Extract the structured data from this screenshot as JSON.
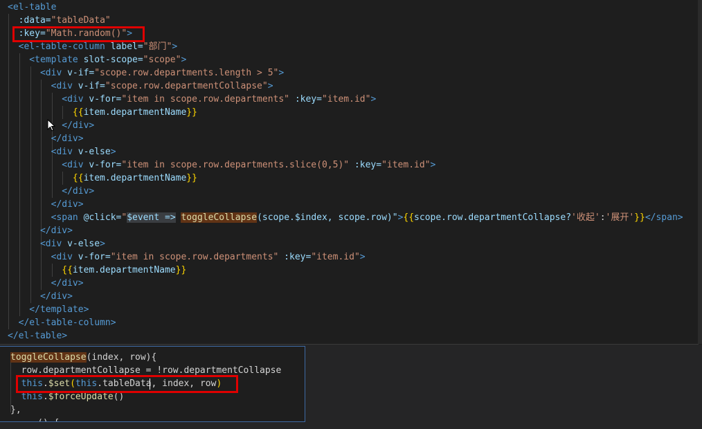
{
  "top_code": [
    [
      {
        "t": "<el-table",
        "c": "tag"
      }
    ],
    [
      {
        "t": "  :data=",
        "c": "attr"
      },
      {
        "t": "\"tableData\"",
        "c": "str"
      }
    ],
    [
      {
        "t": "  :key=",
        "c": "attr"
      },
      {
        "t": "\"Math.random()\"",
        "c": "str"
      },
      {
        "t": ">",
        "c": "tag"
      }
    ],
    [
      {
        "t": "  <el-table-column ",
        "c": "tag"
      },
      {
        "t": "label=",
        "c": "attr"
      },
      {
        "t": "\"部门\"",
        "c": "str"
      },
      {
        "t": ">",
        "c": "tag"
      }
    ],
    [
      {
        "t": "    <template ",
        "c": "tag"
      },
      {
        "t": "slot-scope=",
        "c": "attr"
      },
      {
        "t": "\"scope\"",
        "c": "str"
      },
      {
        "t": ">",
        "c": "tag"
      }
    ],
    [
      {
        "t": "      <div ",
        "c": "tag"
      },
      {
        "t": "v-if=",
        "c": "attr"
      },
      {
        "t": "\"scope.row.departments.length > 5\"",
        "c": "str"
      },
      {
        "t": ">",
        "c": "tag"
      }
    ],
    [
      {
        "t": "        <div ",
        "c": "tag"
      },
      {
        "t": "v-if=",
        "c": "attr"
      },
      {
        "t": "\"scope.row.departmentCollapse\"",
        "c": "str"
      },
      {
        "t": ">",
        "c": "tag"
      }
    ],
    [
      {
        "t": "          <div ",
        "c": "tag"
      },
      {
        "t": "v-for=",
        "c": "attr"
      },
      {
        "t": "\"item in scope.row.departments\"",
        "c": "str"
      },
      {
        "t": " :key=",
        "c": "attr"
      },
      {
        "t": "\"item.id\"",
        "c": "str"
      },
      {
        "t": ">",
        "c": "tag"
      }
    ],
    [
      {
        "t": "            {{",
        "c": "brace"
      },
      {
        "t": "item.departmentName",
        "c": "attr"
      },
      {
        "t": "}}",
        "c": "brace"
      }
    ],
    [
      {
        "t": "          </div>",
        "c": "tag"
      }
    ],
    [
      {
        "t": "        </div>",
        "c": "tag"
      }
    ],
    [
      {
        "t": "        <div ",
        "c": "tag"
      },
      {
        "t": "v-else",
        "c": "attr"
      },
      {
        "t": ">",
        "c": "tag"
      }
    ],
    [
      {
        "t": "          <div ",
        "c": "tag"
      },
      {
        "t": "v-for=",
        "c": "attr"
      },
      {
        "t": "\"item in scope.row.departments.slice(0,5)\"",
        "c": "str"
      },
      {
        "t": " :key=",
        "c": "attr"
      },
      {
        "t": "\"item.id\"",
        "c": "str"
      },
      {
        "t": ">",
        "c": "tag"
      }
    ],
    [
      {
        "t": "            {{",
        "c": "brace"
      },
      {
        "t": "item.departmentName",
        "c": "attr"
      },
      {
        "t": "}}",
        "c": "brace"
      }
    ],
    [
      {
        "t": "          </div>",
        "c": "tag"
      }
    ],
    [
      {
        "t": "        </div>",
        "c": "tag"
      }
    ],
    [
      {
        "t": "        <span ",
        "c": "tag"
      },
      {
        "t": "@click=",
        "c": "attr"
      },
      {
        "t": "\"",
        "c": "str"
      },
      {
        "t": "$event =>",
        "c": "ev"
      },
      {
        "t": " ",
        "c": "txt"
      },
      {
        "t": "toggleCollapse",
        "c": "fnhl"
      },
      {
        "t": "(scope.$index, scope.row)\"",
        "c": "attr"
      },
      {
        "t": ">",
        "c": "tag"
      },
      {
        "t": "{{",
        "c": "brace"
      },
      {
        "t": "scope.row.departmentCollapse?",
        "c": "attr"
      },
      {
        "t": "'收起'",
        "c": "str"
      },
      {
        "t": ":",
        "c": "txt"
      },
      {
        "t": "'展开'",
        "c": "str"
      },
      {
        "t": "}}",
        "c": "brace"
      },
      {
        "t": "</span>",
        "c": "tag"
      }
    ],
    [
      {
        "t": "      </div>",
        "c": "tag"
      }
    ],
    [
      {
        "t": "      <div ",
        "c": "tag"
      },
      {
        "t": "v-else",
        "c": "attr"
      },
      {
        "t": ">",
        "c": "tag"
      }
    ],
    [
      {
        "t": "        <div ",
        "c": "tag"
      },
      {
        "t": "v-for=",
        "c": "attr"
      },
      {
        "t": "\"item in scope.row.departments\"",
        "c": "str"
      },
      {
        "t": " :key=",
        "c": "attr"
      },
      {
        "t": "\"item.id\"",
        "c": "str"
      },
      {
        "t": ">",
        "c": "tag"
      }
    ],
    [
      {
        "t": "          {{",
        "c": "brace"
      },
      {
        "t": "item.departmentName",
        "c": "attr"
      },
      {
        "t": "}}",
        "c": "brace"
      }
    ],
    [
      {
        "t": "        </div>",
        "c": "tag"
      }
    ],
    [
      {
        "t": "      </div>",
        "c": "tag"
      }
    ],
    [
      {
        "t": "    </template>",
        "c": "tag"
      }
    ],
    [
      {
        "t": "  </el-table-column>",
        "c": "tag"
      }
    ],
    [
      {
        "t": "</el-table>",
        "c": "tag"
      }
    ]
  ],
  "bottom_code": [
    [
      {
        "t": "toggleCollapse",
        "c": "fnhl"
      },
      {
        "t": "(index, row){",
        "c": "txt"
      }
    ],
    [
      {
        "t": "  row.departmentCollapse = !row.departmentCollapse",
        "c": "txt"
      }
    ],
    [
      {
        "t": "  this",
        "c": "kw"
      },
      {
        "t": ".",
        "c": "txt"
      },
      {
        "t": "$set",
        "c": "fn"
      },
      {
        "t": "(",
        "c": "brace"
      },
      {
        "t": "this",
        "c": "kw"
      },
      {
        "t": ".tableData, index, row",
        "c": "txt"
      },
      {
        "t": ")",
        "c": "brace"
      }
    ],
    [
      {
        "t": "  this",
        "c": "kw"
      },
      {
        "t": ".",
        "c": "txt"
      },
      {
        "t": "$forceUpdate",
        "c": "fn"
      },
      {
        "t": "()",
        "c": "txt"
      }
    ],
    [
      {
        "t": "},",
        "c": "txt"
      }
    ],
    [
      {
        "t": "  ...() {",
        "c": "txt"
      }
    ]
  ],
  "colors": {
    "tag": "#569cd6",
    "attr": "#9cdcfe",
    "string": "#ce9178",
    "function": "#dcdcaa",
    "brace": "#ffd700",
    "highlight_box": "#e00000"
  }
}
